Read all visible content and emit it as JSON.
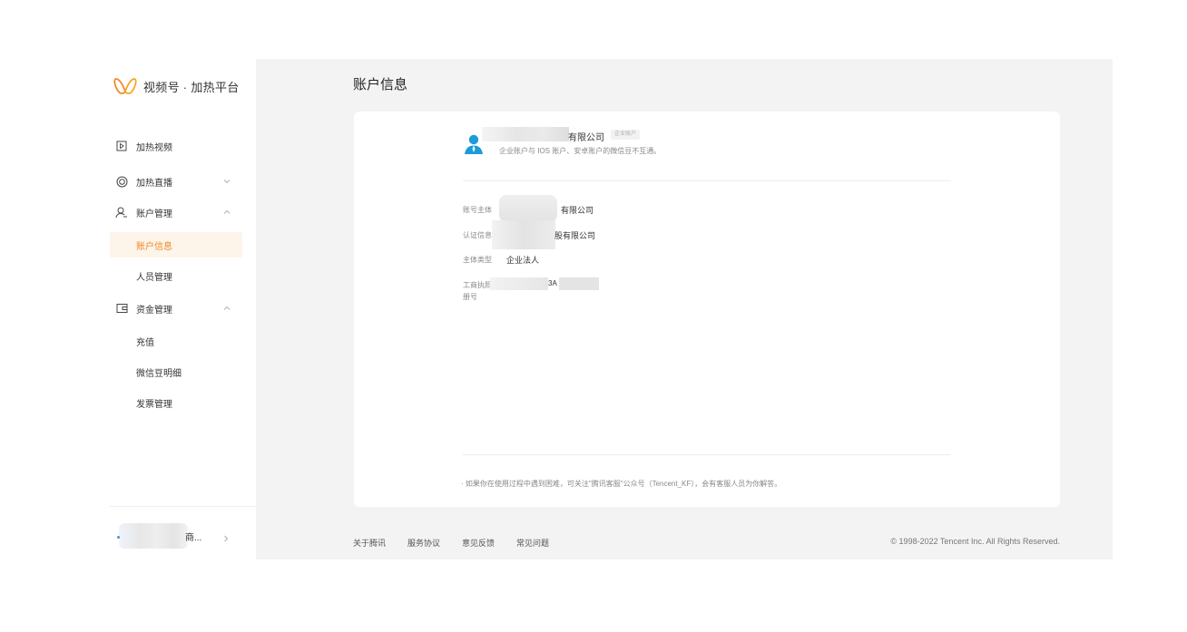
{
  "brand": {
    "name": "视频号 · 加热平台",
    "accent": "#f08a24",
    "icon": "butterfly-logo-icon"
  },
  "sidebar": {
    "items": [
      {
        "label": "加热视频",
        "icon": "video-play-icon"
      },
      {
        "label": "加热直播",
        "icon": "live-circle-icon"
      },
      {
        "label": "账户管理",
        "icon": "user-icon",
        "children": [
          {
            "label": "账户信息",
            "active": true
          },
          {
            "label": "人员管理"
          }
        ]
      },
      {
        "label": "资金管理",
        "icon": "wallet-icon",
        "children": [
          {
            "label": "充值"
          },
          {
            "label": "微信豆明细"
          },
          {
            "label": "发票管理"
          }
        ]
      }
    ],
    "user": {
      "name_suffix": "商..."
    }
  },
  "page": {
    "title": "账户信息"
  },
  "account": {
    "name_suffix": "有限公司",
    "badge": "企业账户",
    "note": "企业账户与 IOS 账户、安卓账户的微信豆不互通。"
  },
  "details": [
    {
      "label": "账号主体",
      "label_visible": "账号主体",
      "value": "有限公司"
    },
    {
      "label_visible": "认证信息",
      "value": "股有限公司"
    },
    {
      "label": "主体类型",
      "value": "企业法人"
    },
    {
      "label_line1": "工商执照",
      "label_line2": "册号",
      "value": "3A"
    }
  ],
  "footnote": "· 如果你在使用过程中遇到困难，可关注\"腾讯客服\"公众号（Tencent_KF），会有客服人员为你解答。",
  "footer": {
    "links": [
      "关于腾讯",
      "服务协议",
      "意见反馈",
      "常见问题"
    ],
    "copyright": "© 1998-2022 Tencent Inc. All Rights Reserved."
  }
}
